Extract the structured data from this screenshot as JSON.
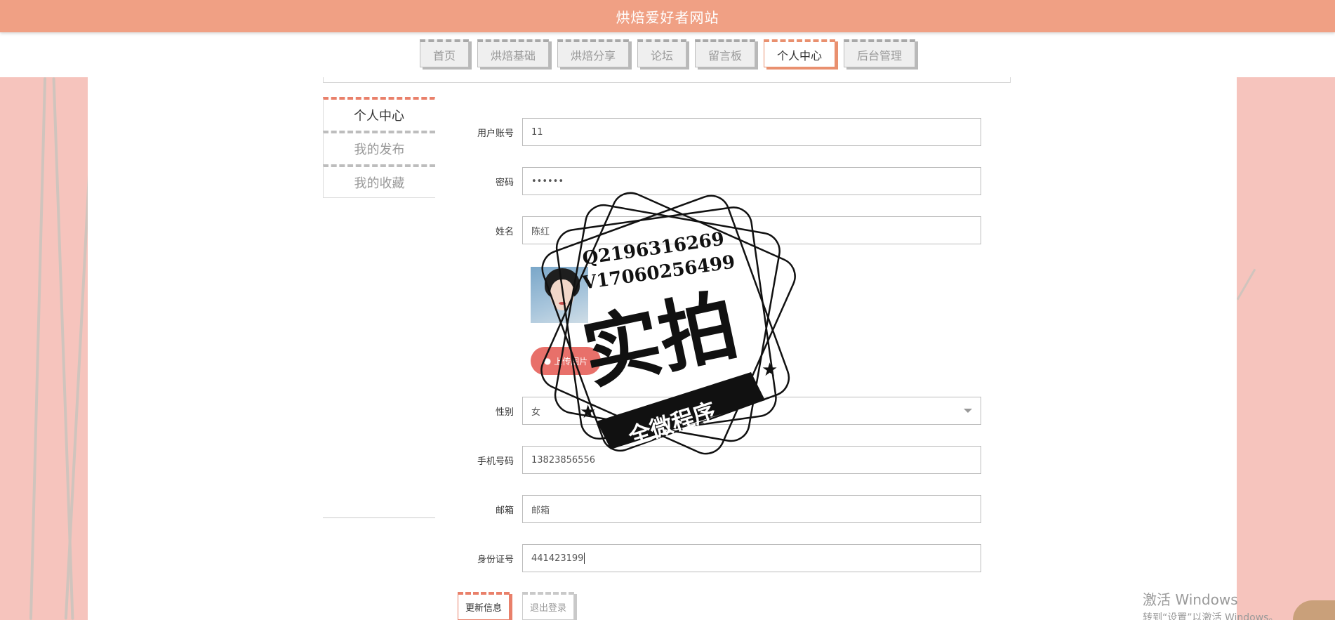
{
  "header": {
    "title": "烘焙爱好者网站",
    "bg_color": "#f0a084"
  },
  "nav": {
    "tabs": [
      {
        "label": "首页",
        "active": false
      },
      {
        "label": "烘焙基础",
        "active": false
      },
      {
        "label": "烘焙分享",
        "active": false
      },
      {
        "label": "论坛",
        "active": false
      },
      {
        "label": "留言板",
        "active": false
      },
      {
        "label": "个人中心",
        "active": true
      },
      {
        "label": "后台管理",
        "active": false
      }
    ]
  },
  "sidebar": {
    "items": [
      {
        "label": "个人中心",
        "active": true
      },
      {
        "label": "我的发布",
        "active": false
      },
      {
        "label": "我的收藏",
        "active": false
      }
    ]
  },
  "form": {
    "account": {
      "label": "用户账号",
      "value": "11"
    },
    "password": {
      "label": "密码",
      "value": "••••••"
    },
    "name": {
      "label": "姓名",
      "value": "陈红"
    },
    "avatar": {
      "icon": "avatar-image"
    },
    "upload": {
      "label": "上传图片",
      "icon": "upload-icon"
    },
    "gender": {
      "label": "性别",
      "value": "女"
    },
    "phone": {
      "label": "手机号码",
      "value": "13823856556"
    },
    "email": {
      "label": "邮箱",
      "placeholder": "邮箱"
    },
    "idcard": {
      "label": "身份证号",
      "value": "441423199"
    }
  },
  "actions": {
    "update": "更新信息",
    "logout": "退出登录"
  },
  "watermark": {
    "line1": "Q2196316269",
    "line2": "V17060256499",
    "main": "实拍",
    "ribbon": "全微程序"
  },
  "system": {
    "activate_line1": "激活 Windows",
    "activate_line2": "转到“设置”以激活 Windows。"
  },
  "colors": {
    "accent": "#e9806a",
    "deco": "#f6c4bd"
  }
}
